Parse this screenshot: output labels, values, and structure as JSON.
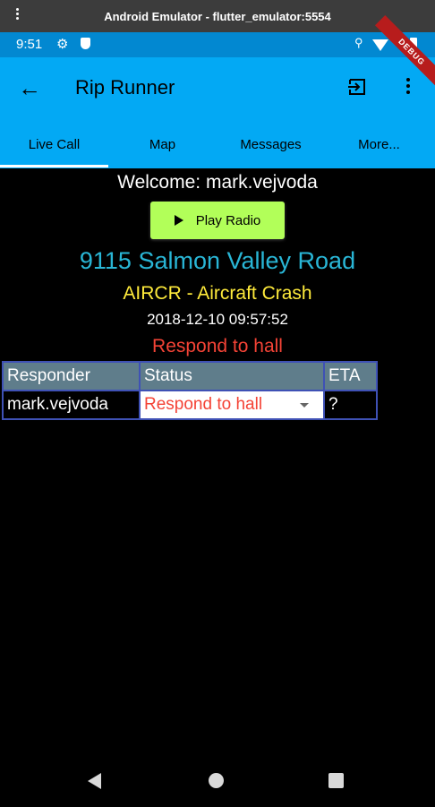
{
  "window": {
    "title": "Android Emulator - flutter_emulator:5554"
  },
  "status_bar": {
    "time": "9:51"
  },
  "debug_ribbon": "DEBUG",
  "app_bar": {
    "title": "Rip Runner"
  },
  "tabs": [
    {
      "label": "Live Call",
      "selected": true
    },
    {
      "label": "Map"
    },
    {
      "label": "Messages"
    },
    {
      "label": "More..."
    }
  ],
  "live_call": {
    "welcome": "Welcome: mark.vejvoda",
    "play_button": "Play Radio",
    "address": "9115 Salmon Valley Road",
    "call_type": "AIRCR - Aircraft Crash",
    "datetime": "2018-12-10 09:57:52",
    "status": "Respond to hall"
  },
  "responders_table": {
    "headers": [
      "Responder",
      "Status",
      "ETA"
    ],
    "rows": [
      {
        "responder": "mark.vejvoda",
        "status": "Respond to hall",
        "eta": "?"
      }
    ]
  },
  "colors": {
    "app_bar": "#03a9f4",
    "status_bar": "#0288d1",
    "play_button": "#b2ff59",
    "address": "#29b6d6",
    "call_type": "#ffeb3b",
    "status": "#f44336",
    "table_header": "#5f7d8b",
    "table_border": "#3f51b5"
  }
}
